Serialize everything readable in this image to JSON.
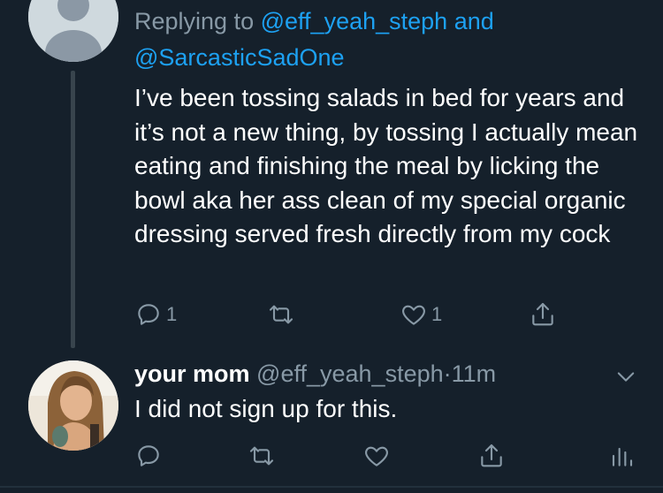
{
  "reply_context": {
    "prefix": "Replying to",
    "mention1": "@eff_yeah_steph",
    "joiner": "and",
    "mention2": "@SarcasticSadOne"
  },
  "tweet1": {
    "text": "I’ve been tossing salads in bed for years and it’s not a new thing, by tossing I actually mean eating and finishing the meal by licking the bowl aka her ass clean of my special organic dressing served fresh directly from my cock",
    "reply_count": "1",
    "like_count": "1"
  },
  "tweet2": {
    "name": "your mom",
    "handle": "@eff_yeah_steph",
    "separator": "·",
    "time": "11m",
    "text": "I did not sign up for this."
  },
  "icons": {
    "reply": "reply-icon",
    "retweet": "retweet-icon",
    "like": "heart-icon",
    "share": "share-icon",
    "analytics": "analytics-icon",
    "more": "chevron-down-icon"
  },
  "colors": {
    "background": "#15202b",
    "text": "#ffffff",
    "secondary": "#8899a6",
    "accent": "#1da1f2",
    "thread_line": "#38444d"
  }
}
